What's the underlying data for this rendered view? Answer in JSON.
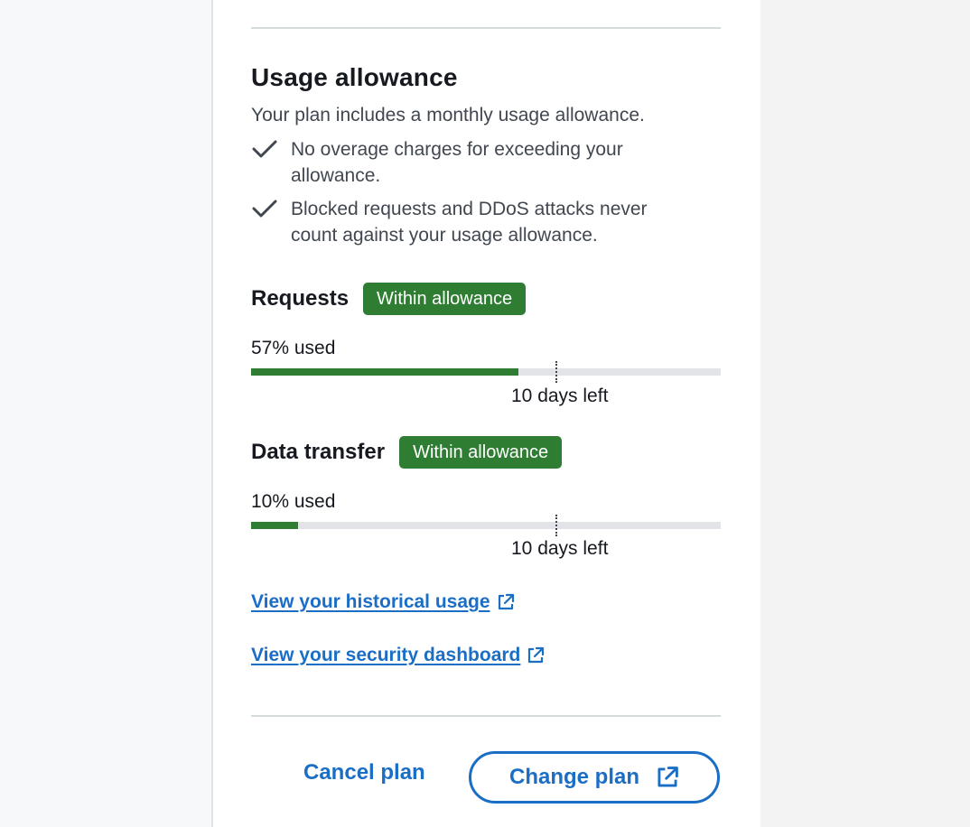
{
  "usage": {
    "title": "Usage allowance",
    "description": "Your plan includes a monthly usage allowance.",
    "checks": [
      "No overage charges for exceeding your allowance.",
      "Blocked requests and DDoS attacks never count against your usage allowance."
    ]
  },
  "metrics": [
    {
      "title": "Requests",
      "badge": "Within allowance",
      "used_label": "57% used",
      "used_fraction": 0.57,
      "days_left": "10 days left"
    },
    {
      "title": "Data transfer",
      "badge": "Within allowance",
      "used_label": "10% used",
      "used_fraction": 0.1,
      "days_left": "10 days left"
    }
  ],
  "links": {
    "historical": "View your historical usage",
    "security": "View your security dashboard"
  },
  "footer": {
    "cancel_label": "Cancel plan",
    "change_label": "Change plan"
  },
  "icons": {
    "check": "check-icon",
    "external": "external-link-icon"
  },
  "colors": {
    "accent": "#1a6ec6",
    "success": "#2e7d32"
  }
}
